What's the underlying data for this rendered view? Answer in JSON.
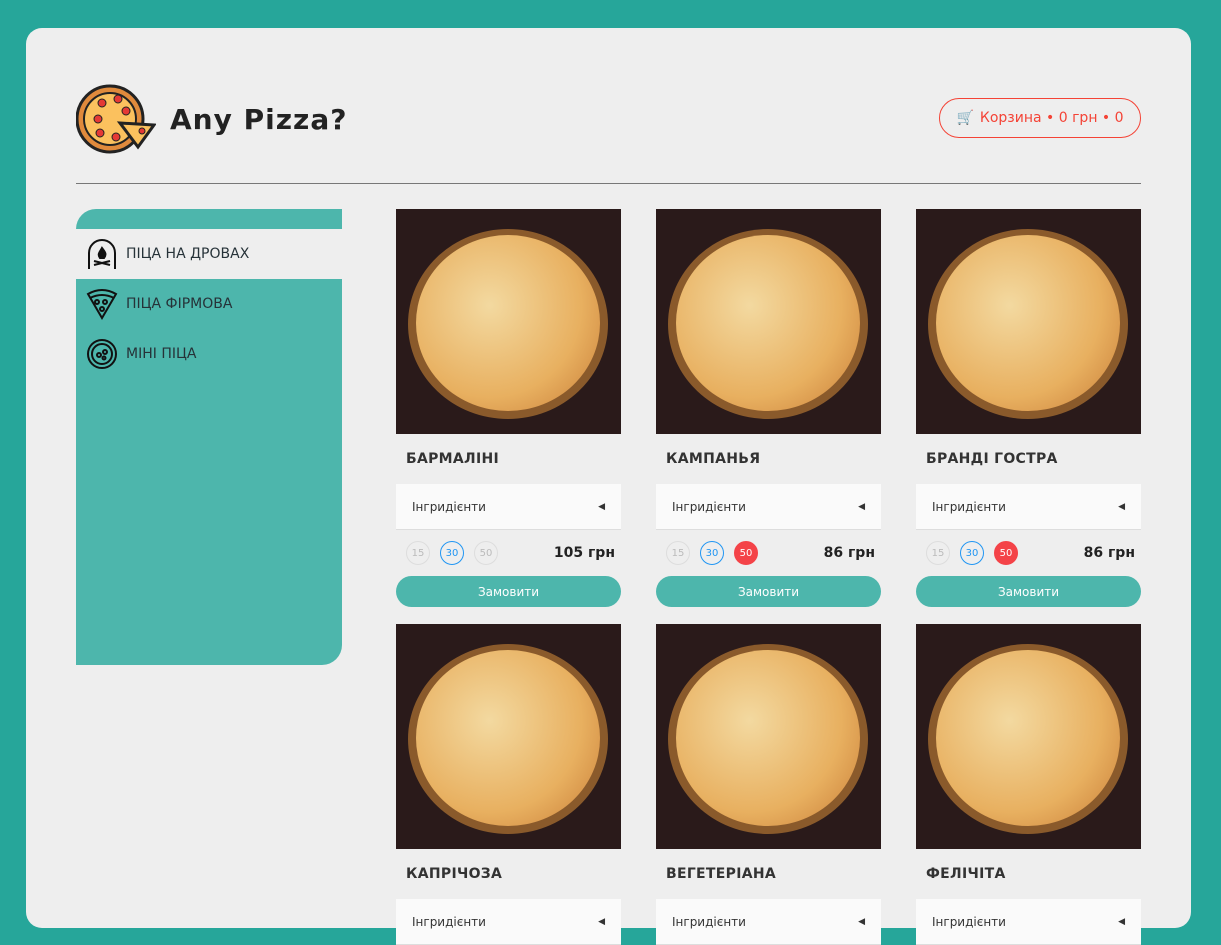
{
  "logo": {
    "text": "Any Pizza?"
  },
  "cart": {
    "label": "Корзина • 0 грн • 0"
  },
  "sidebar": {
    "items": [
      {
        "label": "ПІЦА НА ДРОВАХ",
        "icon": "wood-oven-icon",
        "active": true
      },
      {
        "label": "ПІЦА ФІРМОВА",
        "icon": "pizza-slice-icon"
      },
      {
        "label": "МІНІ ПІЦА",
        "icon": "mini-pizza-icon"
      }
    ]
  },
  "products": [
    {
      "name": "БАРМАЛІНІ",
      "ingredients": "Інгридієнти",
      "sizes": [
        "15",
        "30",
        "50"
      ],
      "selected": "30",
      "price": "105 грн",
      "order": "Замовити"
    },
    {
      "name": "КАМПАНЬЯ",
      "ingredients": "Інгридієнти",
      "sizes": [
        "15",
        "30",
        "50"
      ],
      "selected": "30",
      "active": "50",
      "price": "86 грн",
      "order": "Замовити"
    },
    {
      "name": "БРАНДІ ГОСТРА",
      "ingredients": "Інгридієнти",
      "sizes": [
        "15",
        "30",
        "50"
      ],
      "selected": "30",
      "active": "50",
      "price": "86 грн",
      "order": "Замовити"
    },
    {
      "name": "КАПРІЧОЗА",
      "ingredients": "Інгридієнти"
    },
    {
      "name": "ВЕГЕТЕРІАНА",
      "ingredients": "Інгридієнти"
    },
    {
      "name": "ФЕЛІЧІТА",
      "ingredients": "Інгридієнти"
    }
  ],
  "colors": {
    "page": "#26a69a",
    "accent": "#4db6ac",
    "cart": "#f44336",
    "selected": "#2196f3"
  }
}
